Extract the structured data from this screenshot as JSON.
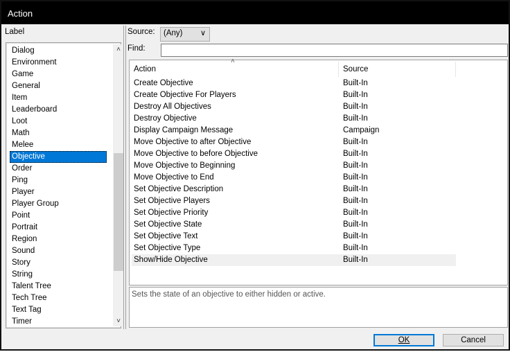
{
  "window": {
    "title": "Action"
  },
  "left": {
    "label": "Label",
    "items": [
      "Dialog",
      "Environment",
      "Game",
      "General",
      "Item",
      "Leaderboard",
      "Loot",
      "Math",
      "Melee",
      "Objective",
      "Order",
      "Ping",
      "Player",
      "Player Group",
      "Point",
      "Portrait",
      "Region",
      "Sound",
      "Story",
      "String",
      "Talent Tree",
      "Tech Tree",
      "Text Tag",
      "Timer"
    ],
    "selected": "Objective"
  },
  "filter": {
    "source_label": "Source:",
    "source_value": "(Any)",
    "find_label": "Find:",
    "find_value": ""
  },
  "table": {
    "columns": [
      "Action",
      "Source"
    ],
    "rows": [
      [
        "Create Objective",
        "Built-In"
      ],
      [
        "Create Objective For Players",
        "Built-In"
      ],
      [
        "Destroy All Objectives",
        "Built-In"
      ],
      [
        "Destroy Objective",
        "Built-In"
      ],
      [
        "Display Campaign Message",
        "Campaign"
      ],
      [
        "Move Objective to after Objective",
        "Built-In"
      ],
      [
        "Move Objective to before Objective",
        "Built-In"
      ],
      [
        "Move Objective to Beginning",
        "Built-In"
      ],
      [
        "Move Objective to End",
        "Built-In"
      ],
      [
        "Set Objective Description",
        "Built-In"
      ],
      [
        "Set Objective Players",
        "Built-In"
      ],
      [
        "Set Objective Priority",
        "Built-In"
      ],
      [
        "Set Objective State",
        "Built-In"
      ],
      [
        "Set Objective Text",
        "Built-In"
      ],
      [
        "Set Objective Type",
        "Built-In"
      ],
      [
        "Show/Hide Objective",
        "Built-In"
      ]
    ],
    "selected_index": 15
  },
  "description": "Sets the state of an objective to either hidden or active.",
  "buttons": {
    "ok": "OK",
    "cancel": "Cancel"
  }
}
